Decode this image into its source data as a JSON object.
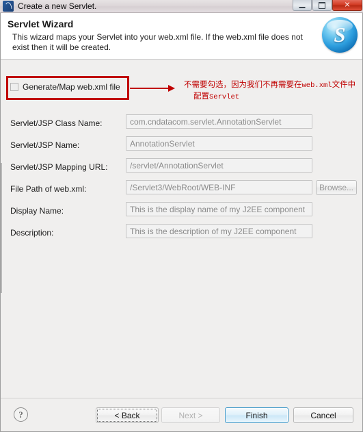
{
  "window": {
    "title": "Create a new Servlet.",
    "app_icon": "servlet-app-icon",
    "controls": {
      "minimize": "minimize-button",
      "maximize": "maximize-button",
      "close_glyph": "✕"
    }
  },
  "header": {
    "title": "Servlet Wizard",
    "description": "This wizard maps your Servlet into your web.xml file. If the web.xml file does not exist then it will be created.",
    "logo_letter": "S"
  },
  "checkbox": {
    "label": "Generate/Map web.xml file",
    "checked": false
  },
  "annotation": {
    "color": "#c00000",
    "line1_a": "不需要勾选，因为我们不再需要在",
    "line1_mono": "web.xml",
    "line1_b": "文件中",
    "line2_a": "配置",
    "line2_mono": "Servlet"
  },
  "form": {
    "fields": [
      {
        "label": "Servlet/JSP Class Name:",
        "value": "com.cndatacom.servlet.AnnotationServlet",
        "disabled": true
      },
      {
        "label": "Servlet/JSP Name:",
        "value": "AnnotationServlet",
        "disabled": true
      },
      {
        "label": "Servlet/JSP Mapping URL:",
        "value": "/servlet/AnnotationServlet",
        "disabled": true
      },
      {
        "label": "File Path of web.xml:",
        "value": "/Servlet3/WebRoot/WEB-INF",
        "disabled": true,
        "browse": "Browse..."
      },
      {
        "label": "Display Name:",
        "value": "This is the display name of my J2EE component",
        "disabled": true
      },
      {
        "label": "Description:",
        "value": "This is the description of my J2EE component",
        "disabled": true
      }
    ]
  },
  "footer": {
    "help_glyph": "?",
    "buttons": {
      "back": "< Back",
      "next": "Next >",
      "finish": "Finish",
      "cancel": "Cancel"
    }
  }
}
